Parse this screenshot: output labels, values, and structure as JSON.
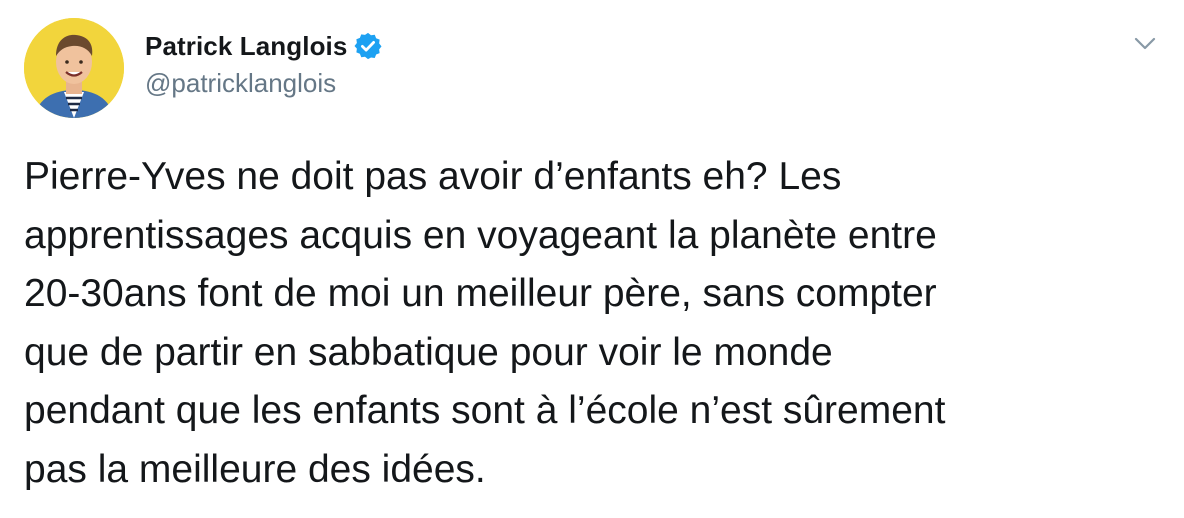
{
  "author": {
    "display_name": "Patrick Langlois",
    "handle": "@patricklanglois",
    "verified": true,
    "avatar_icon": "profile-photo"
  },
  "menu": {
    "icon": "chevron-down-icon"
  },
  "tweet": {
    "text": "Pierre-Yves ne doit pas avoir d’enfants eh? Les\napprentissages acquis en voyageant la planète entre\n20-30ans font de moi un meilleur père, sans compter\nque de partir en sabbatique pour voir le monde\npendant que les enfants sont à l’école n’est sûrement\npas la meilleure des idées."
  },
  "colors": {
    "text": "#14171a",
    "secondary": "#657786",
    "verified_blue": "#1da1f2",
    "avatar_background": "#f2d53c"
  }
}
